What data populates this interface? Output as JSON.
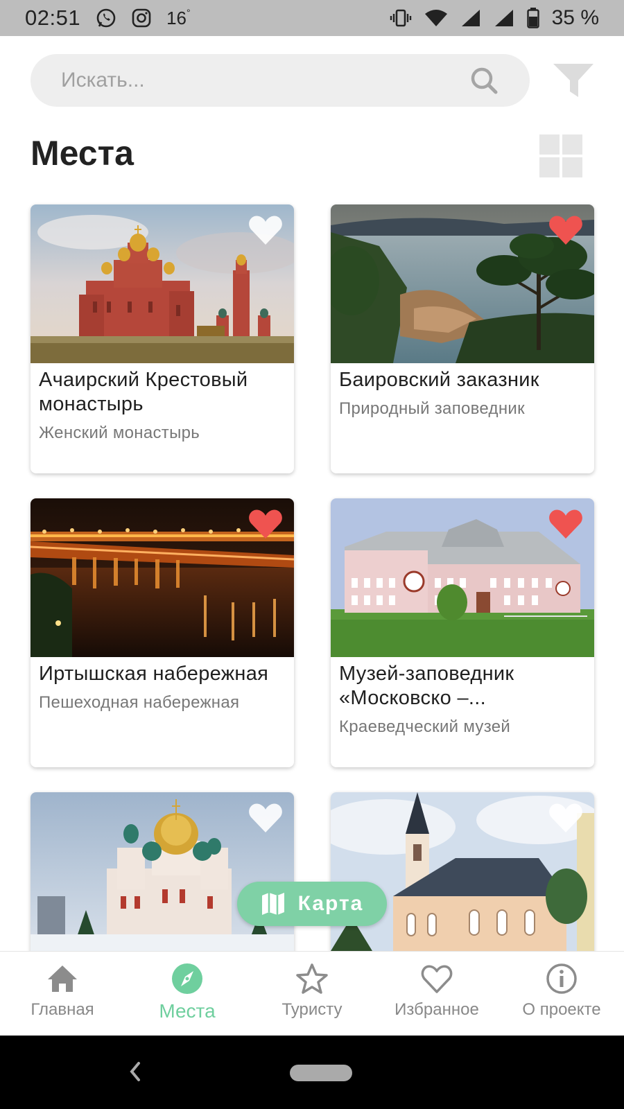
{
  "status_bar": {
    "time": "02:51",
    "temperature": "16",
    "battery": "35 %"
  },
  "search": {
    "placeholder": "Искать..."
  },
  "page": {
    "title": "Места"
  },
  "places": [
    {
      "title": "Ачаирский Крестовый монастырь",
      "subtitle": "Женский монастырь",
      "favorite": false
    },
    {
      "title": "Баировский заказник",
      "subtitle": "Природный заповедник",
      "favorite": true
    },
    {
      "title": "Иртышская набережная",
      "subtitle": "Пешеходная набережная",
      "favorite": true
    },
    {
      "title": "Музей-заповедник «Московско –...",
      "subtitle": "Краеведческий музей",
      "favorite": true
    },
    {
      "title": "",
      "subtitle": "",
      "favorite": false
    },
    {
      "title": "",
      "subtitle": "",
      "favorite": false
    }
  ],
  "map_button": {
    "label": "Карта"
  },
  "bottom_nav": [
    {
      "label": "Главная",
      "icon": "home-icon",
      "active": false
    },
    {
      "label": "Места",
      "icon": "compass-icon",
      "active": true
    },
    {
      "label": "Туристу",
      "icon": "star-icon",
      "active": false
    },
    {
      "label": "Избранное",
      "icon": "heart-icon",
      "active": false
    },
    {
      "label": "О проекте",
      "icon": "info-icon",
      "active": false
    }
  ],
  "colors": {
    "accent": "#6fcf9e",
    "favorite_active": "#ef5350",
    "favorite_inactive": "#ffffff"
  }
}
